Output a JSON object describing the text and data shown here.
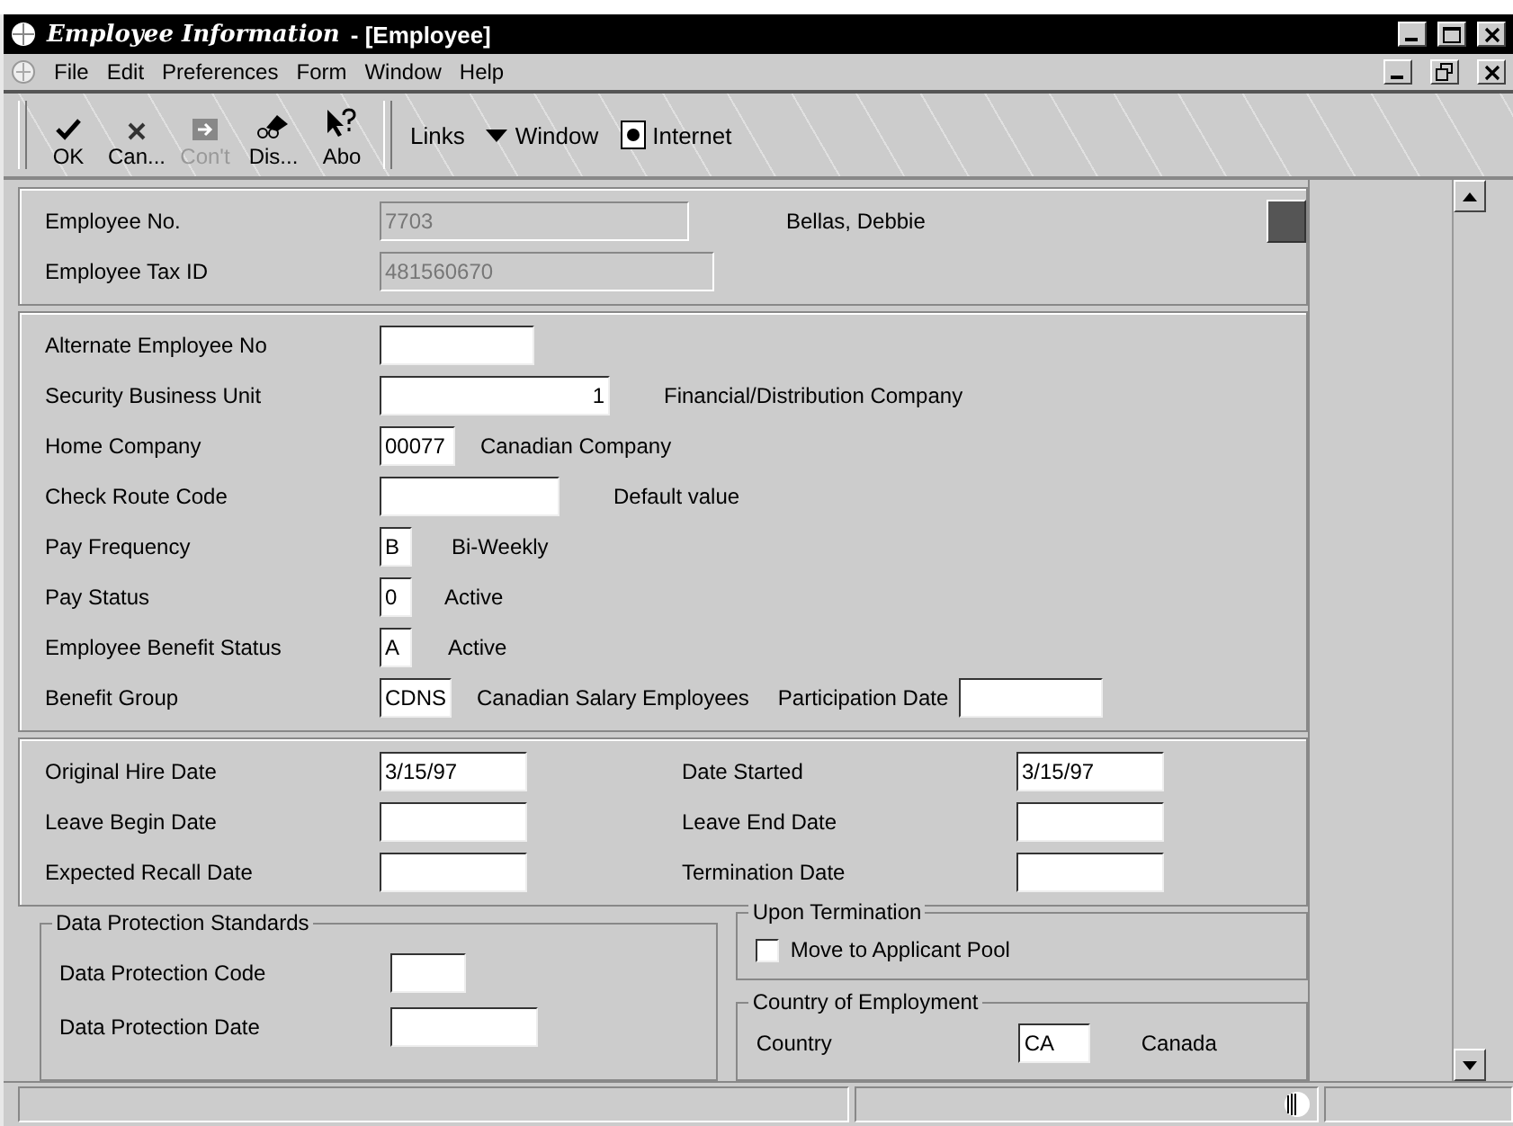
{
  "window": {
    "title": "Employee Information",
    "subtitle": " - [Employee]"
  },
  "menu": [
    "File",
    "Edit",
    "Preferences",
    "Form",
    "Window",
    "Help"
  ],
  "toolbar": [
    {
      "label": "OK",
      "disabled": false
    },
    {
      "label": "Can...",
      "disabled": false
    },
    {
      "label": "Con't",
      "disabled": true
    },
    {
      "label": "Dis...",
      "disabled": false
    },
    {
      "label": "Abo",
      "disabled": false
    }
  ],
  "links": [
    {
      "label": "Links"
    },
    {
      "label": "Window"
    },
    {
      "label": "Internet"
    }
  ],
  "header": {
    "employee_no_label": "Employee No.",
    "employee_no": "7703",
    "name": "Bellas, Debbie",
    "tax_id_label": "Employee Tax ID",
    "tax_id": "481560670"
  },
  "details": [
    {
      "label": "Alternate Employee No"
    },
    {
      "label": "Security Business Unit",
      "value": "1",
      "description": "Financial/Distribution Company"
    },
    {
      "label": "Home Company",
      "value": "00077",
      "description": "Canadian Company"
    },
    {
      "label": "Check Route Code",
      "description": "Default value"
    },
    {
      "label": "Pay Frequency",
      "value": "B",
      "description": "Bi-Weekly"
    },
    {
      "label": "Pay Status",
      "value": "0",
      "description": "Active"
    },
    {
      "label": "Employee Benefit Status",
      "value": "A",
      "description": "Active"
    },
    {
      "label": "Benefit Group",
      "value": "CDNS",
      "description": "Canadian Salary Employees",
      "extra_label": "Participation Date"
    }
  ],
  "dates_left": [
    {
      "label": "Original Hire Date",
      "value": "3/15/97"
    },
    {
      "label": "Leave Begin Date"
    },
    {
      "label": "Expected Recall Date"
    }
  ],
  "dates_right": [
    {
      "label": "Date Started",
      "value": "3/15/97"
    },
    {
      "label": "Leave End Date"
    },
    {
      "label": "Termination Date"
    }
  ],
  "data_protection": {
    "title": "Data Protection Standards",
    "fields": [
      {
        "label": "Data Protection Code"
      },
      {
        "label": "Data Protection Date"
      }
    ]
  },
  "upon_termination": {
    "title": "Upon Termination",
    "checkbox": {
      "label": "Move to Applicant Pool",
      "checked": false
    }
  },
  "country": {
    "title": "Country of Employment",
    "label": "Country",
    "value": "CA",
    "description": "Canada"
  }
}
